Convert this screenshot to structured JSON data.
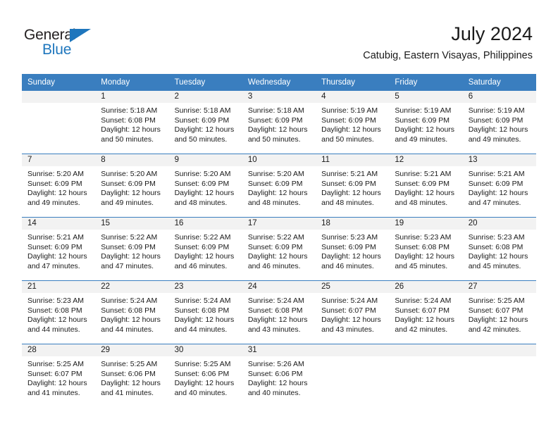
{
  "brand": {
    "name_part1": "General",
    "name_part2": "Blue",
    "accent_color": "#1e76bd"
  },
  "header": {
    "title": "July 2024",
    "subtitle": "Catubig, Eastern Visayas, Philippines",
    "header_bg_color": "#3a7ebf",
    "daynum_bg_color": "#f2f2f2"
  },
  "weekdays": [
    "Sunday",
    "Monday",
    "Tuesday",
    "Wednesday",
    "Thursday",
    "Friday",
    "Saturday"
  ],
  "weeks": [
    [
      {
        "day": "",
        "sunrise": "",
        "sunset": "",
        "daylight1": "",
        "daylight2": ""
      },
      {
        "day": "1",
        "sunrise": "Sunrise: 5:18 AM",
        "sunset": "Sunset: 6:08 PM",
        "daylight1": "Daylight: 12 hours",
        "daylight2": "and 50 minutes."
      },
      {
        "day": "2",
        "sunrise": "Sunrise: 5:18 AM",
        "sunset": "Sunset: 6:09 PM",
        "daylight1": "Daylight: 12 hours",
        "daylight2": "and 50 minutes."
      },
      {
        "day": "3",
        "sunrise": "Sunrise: 5:18 AM",
        "sunset": "Sunset: 6:09 PM",
        "daylight1": "Daylight: 12 hours",
        "daylight2": "and 50 minutes."
      },
      {
        "day": "4",
        "sunrise": "Sunrise: 5:19 AM",
        "sunset": "Sunset: 6:09 PM",
        "daylight1": "Daylight: 12 hours",
        "daylight2": "and 50 minutes."
      },
      {
        "day": "5",
        "sunrise": "Sunrise: 5:19 AM",
        "sunset": "Sunset: 6:09 PM",
        "daylight1": "Daylight: 12 hours",
        "daylight2": "and 49 minutes."
      },
      {
        "day": "6",
        "sunrise": "Sunrise: 5:19 AM",
        "sunset": "Sunset: 6:09 PM",
        "daylight1": "Daylight: 12 hours",
        "daylight2": "and 49 minutes."
      }
    ],
    [
      {
        "day": "7",
        "sunrise": "Sunrise: 5:20 AM",
        "sunset": "Sunset: 6:09 PM",
        "daylight1": "Daylight: 12 hours",
        "daylight2": "and 49 minutes."
      },
      {
        "day": "8",
        "sunrise": "Sunrise: 5:20 AM",
        "sunset": "Sunset: 6:09 PM",
        "daylight1": "Daylight: 12 hours",
        "daylight2": "and 49 minutes."
      },
      {
        "day": "9",
        "sunrise": "Sunrise: 5:20 AM",
        "sunset": "Sunset: 6:09 PM",
        "daylight1": "Daylight: 12 hours",
        "daylight2": "and 48 minutes."
      },
      {
        "day": "10",
        "sunrise": "Sunrise: 5:20 AM",
        "sunset": "Sunset: 6:09 PM",
        "daylight1": "Daylight: 12 hours",
        "daylight2": "and 48 minutes."
      },
      {
        "day": "11",
        "sunrise": "Sunrise: 5:21 AM",
        "sunset": "Sunset: 6:09 PM",
        "daylight1": "Daylight: 12 hours",
        "daylight2": "and 48 minutes."
      },
      {
        "day": "12",
        "sunrise": "Sunrise: 5:21 AM",
        "sunset": "Sunset: 6:09 PM",
        "daylight1": "Daylight: 12 hours",
        "daylight2": "and 48 minutes."
      },
      {
        "day": "13",
        "sunrise": "Sunrise: 5:21 AM",
        "sunset": "Sunset: 6:09 PM",
        "daylight1": "Daylight: 12 hours",
        "daylight2": "and 47 minutes."
      }
    ],
    [
      {
        "day": "14",
        "sunrise": "Sunrise: 5:21 AM",
        "sunset": "Sunset: 6:09 PM",
        "daylight1": "Daylight: 12 hours",
        "daylight2": "and 47 minutes."
      },
      {
        "day": "15",
        "sunrise": "Sunrise: 5:22 AM",
        "sunset": "Sunset: 6:09 PM",
        "daylight1": "Daylight: 12 hours",
        "daylight2": "and 47 minutes."
      },
      {
        "day": "16",
        "sunrise": "Sunrise: 5:22 AM",
        "sunset": "Sunset: 6:09 PM",
        "daylight1": "Daylight: 12 hours",
        "daylight2": "and 46 minutes."
      },
      {
        "day": "17",
        "sunrise": "Sunrise: 5:22 AM",
        "sunset": "Sunset: 6:09 PM",
        "daylight1": "Daylight: 12 hours",
        "daylight2": "and 46 minutes."
      },
      {
        "day": "18",
        "sunrise": "Sunrise: 5:23 AM",
        "sunset": "Sunset: 6:09 PM",
        "daylight1": "Daylight: 12 hours",
        "daylight2": "and 46 minutes."
      },
      {
        "day": "19",
        "sunrise": "Sunrise: 5:23 AM",
        "sunset": "Sunset: 6:08 PM",
        "daylight1": "Daylight: 12 hours",
        "daylight2": "and 45 minutes."
      },
      {
        "day": "20",
        "sunrise": "Sunrise: 5:23 AM",
        "sunset": "Sunset: 6:08 PM",
        "daylight1": "Daylight: 12 hours",
        "daylight2": "and 45 minutes."
      }
    ],
    [
      {
        "day": "21",
        "sunrise": "Sunrise: 5:23 AM",
        "sunset": "Sunset: 6:08 PM",
        "daylight1": "Daylight: 12 hours",
        "daylight2": "and 44 minutes."
      },
      {
        "day": "22",
        "sunrise": "Sunrise: 5:24 AM",
        "sunset": "Sunset: 6:08 PM",
        "daylight1": "Daylight: 12 hours",
        "daylight2": "and 44 minutes."
      },
      {
        "day": "23",
        "sunrise": "Sunrise: 5:24 AM",
        "sunset": "Sunset: 6:08 PM",
        "daylight1": "Daylight: 12 hours",
        "daylight2": "and 44 minutes."
      },
      {
        "day": "24",
        "sunrise": "Sunrise: 5:24 AM",
        "sunset": "Sunset: 6:08 PM",
        "daylight1": "Daylight: 12 hours",
        "daylight2": "and 43 minutes."
      },
      {
        "day": "25",
        "sunrise": "Sunrise: 5:24 AM",
        "sunset": "Sunset: 6:07 PM",
        "daylight1": "Daylight: 12 hours",
        "daylight2": "and 43 minutes."
      },
      {
        "day": "26",
        "sunrise": "Sunrise: 5:24 AM",
        "sunset": "Sunset: 6:07 PM",
        "daylight1": "Daylight: 12 hours",
        "daylight2": "and 42 minutes."
      },
      {
        "day": "27",
        "sunrise": "Sunrise: 5:25 AM",
        "sunset": "Sunset: 6:07 PM",
        "daylight1": "Daylight: 12 hours",
        "daylight2": "and 42 minutes."
      }
    ],
    [
      {
        "day": "28",
        "sunrise": "Sunrise: 5:25 AM",
        "sunset": "Sunset: 6:07 PM",
        "daylight1": "Daylight: 12 hours",
        "daylight2": "and 41 minutes."
      },
      {
        "day": "29",
        "sunrise": "Sunrise: 5:25 AM",
        "sunset": "Sunset: 6:06 PM",
        "daylight1": "Daylight: 12 hours",
        "daylight2": "and 41 minutes."
      },
      {
        "day": "30",
        "sunrise": "Sunrise: 5:25 AM",
        "sunset": "Sunset: 6:06 PM",
        "daylight1": "Daylight: 12 hours",
        "daylight2": "and 40 minutes."
      },
      {
        "day": "31",
        "sunrise": "Sunrise: 5:26 AM",
        "sunset": "Sunset: 6:06 PM",
        "daylight1": "Daylight: 12 hours",
        "daylight2": "and 40 minutes."
      },
      {
        "day": "",
        "sunrise": "",
        "sunset": "",
        "daylight1": "",
        "daylight2": ""
      },
      {
        "day": "",
        "sunrise": "",
        "sunset": "",
        "daylight1": "",
        "daylight2": ""
      },
      {
        "day": "",
        "sunrise": "",
        "sunset": "",
        "daylight1": "",
        "daylight2": ""
      }
    ]
  ]
}
